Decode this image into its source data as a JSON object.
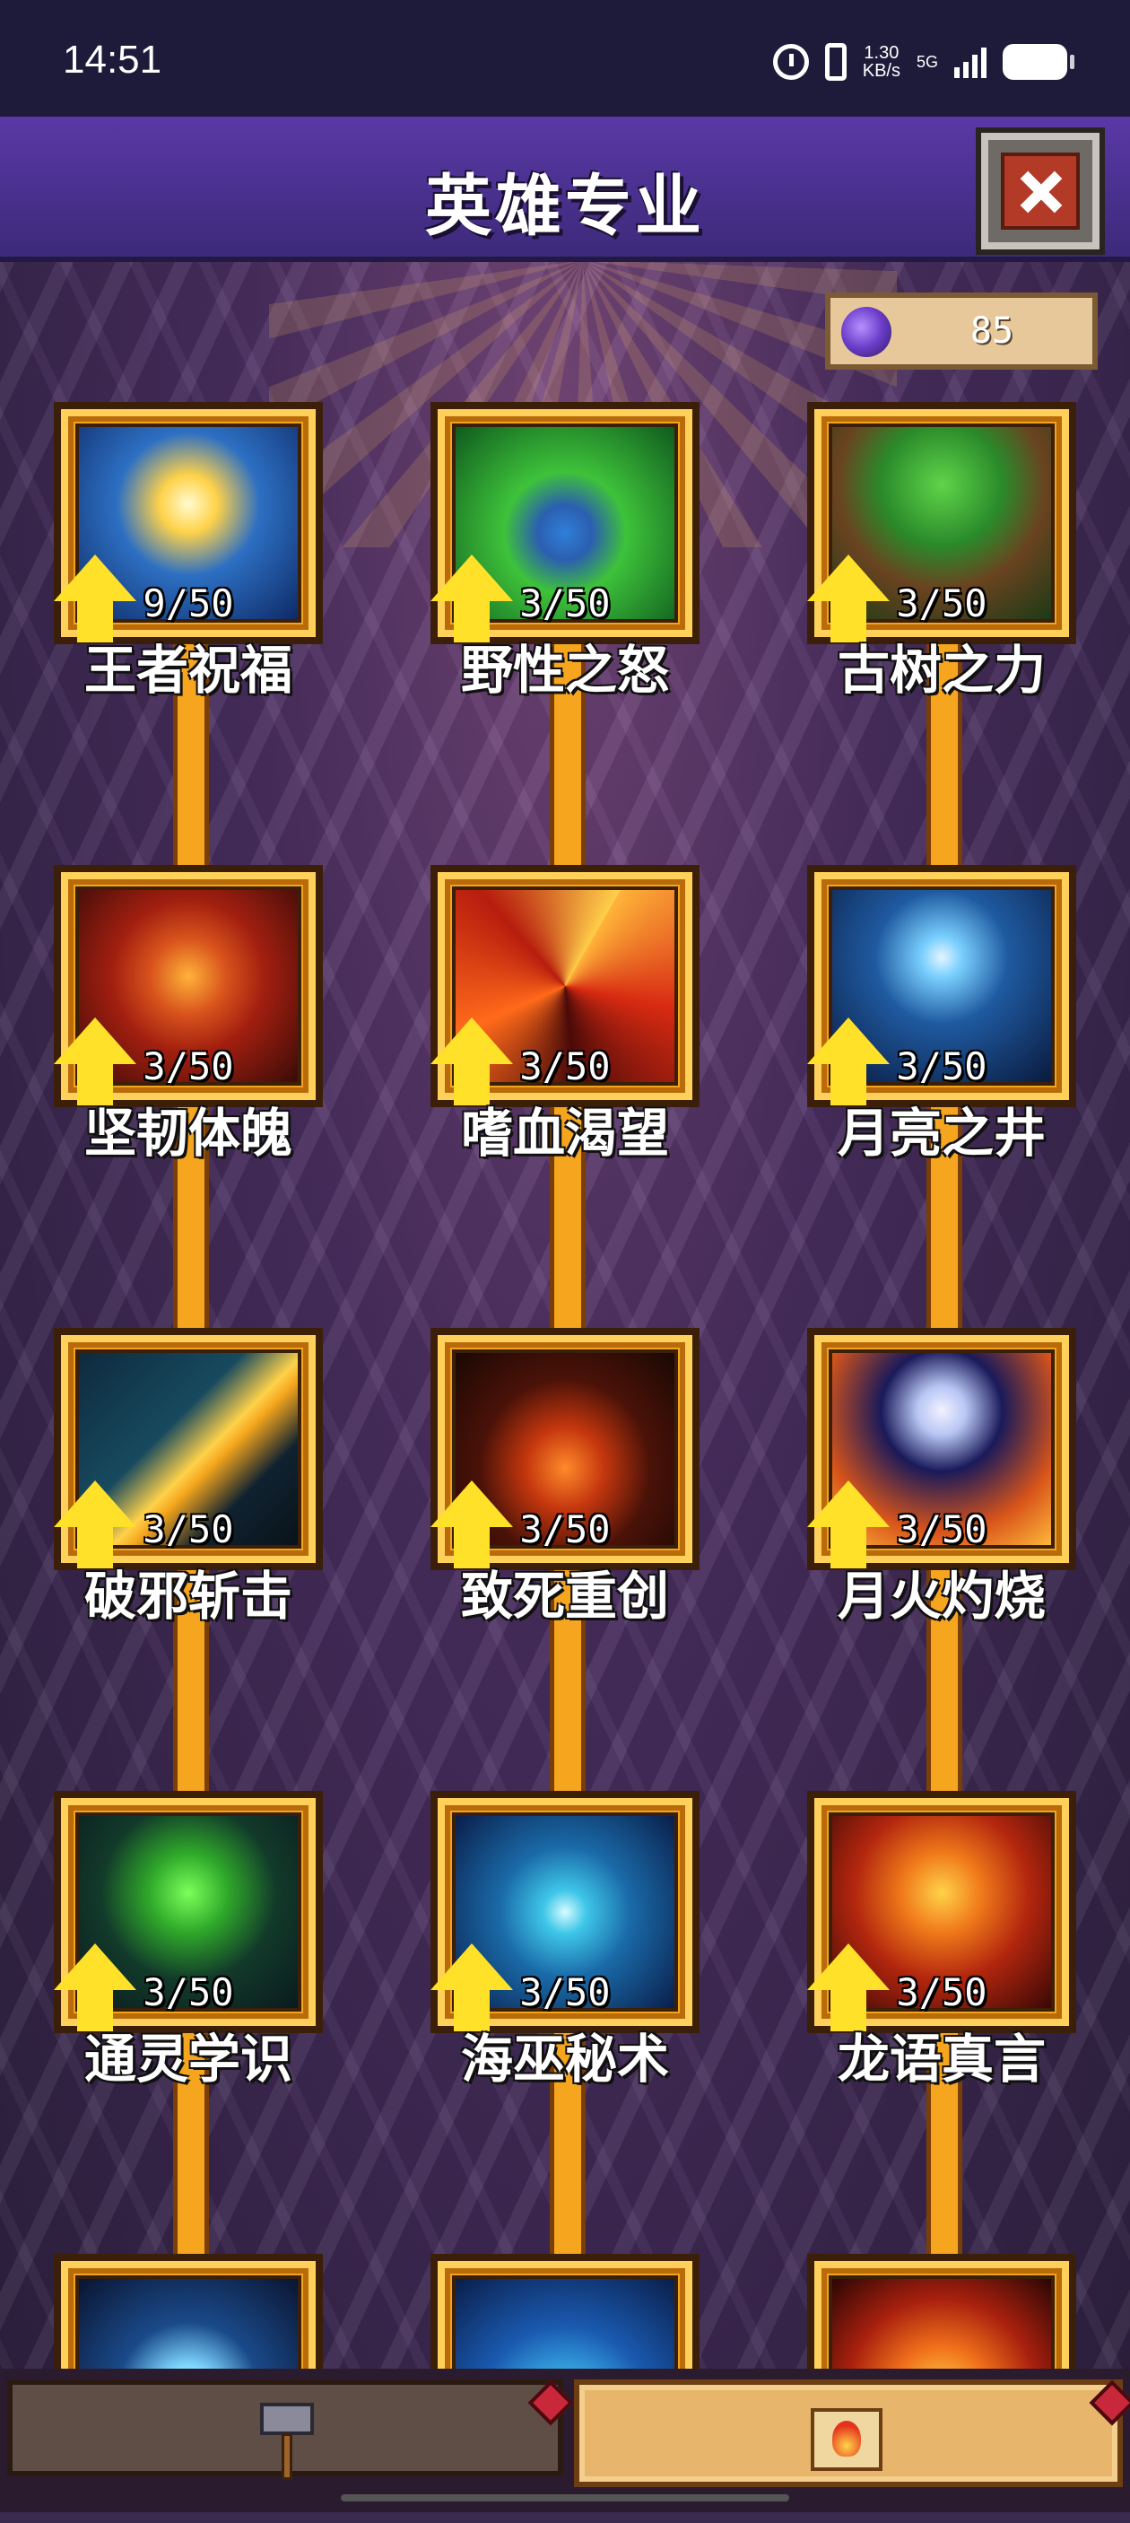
{
  "status_bar": {
    "time": "14:51",
    "net_speed": "1.30",
    "net_unit": "KB/s",
    "network": "5G",
    "icons": [
      "alarm-icon",
      "vibrate-icon",
      "signal-icon",
      "battery-icon"
    ]
  },
  "header": {
    "title": "英雄专业",
    "close_icon": "close-icon"
  },
  "currency": {
    "icon": "purple-gem-icon",
    "value": "85"
  },
  "skills": [
    {
      "name": "王者祝福",
      "level": "9/50",
      "icon": "radiant-star-icon"
    },
    {
      "name": "野性之怒",
      "level": "3/50",
      "icon": "paw-icon"
    },
    {
      "name": "古树之力",
      "level": "3/50",
      "icon": "tree-icon"
    },
    {
      "name": "坚韧体魄",
      "level": "3/50",
      "icon": "shield-icon"
    },
    {
      "name": "嗜血渴望",
      "level": "3/50",
      "icon": "fire-vortex-icon"
    },
    {
      "name": "月亮之井",
      "level": "3/50",
      "icon": "moon-well-icon"
    },
    {
      "name": "破邪斩击",
      "level": "3/50",
      "icon": "slash-icon"
    },
    {
      "name": "致死重创",
      "level": "3/50",
      "icon": "cracked-lava-icon"
    },
    {
      "name": "月火灼烧",
      "level": "3/50",
      "icon": "moonfire-icon"
    },
    {
      "name": "通灵学识",
      "level": "3/50",
      "icon": "necro-book-icon"
    },
    {
      "name": "海巫秘术",
      "level": "3/50",
      "icon": "water-swirl-icon"
    },
    {
      "name": "龙语真言",
      "level": "3/50",
      "icon": "dragon-icon"
    },
    {
      "name": "",
      "level": "",
      "icon": "skull-icon"
    },
    {
      "name": "",
      "level": "",
      "icon": "wave-icon"
    },
    {
      "name": "",
      "level": "",
      "icon": "flame-leaf-icon"
    }
  ],
  "bottom_tabs": [
    {
      "icon": "hammer-icon",
      "active": false
    },
    {
      "icon": "scroll-icon",
      "active": true
    }
  ],
  "colors": {
    "header": "#4b30a0",
    "frame_gold": "#f3a51c",
    "upgrade_arrow": "#ffe12a",
    "close_button": "#b23a27"
  }
}
